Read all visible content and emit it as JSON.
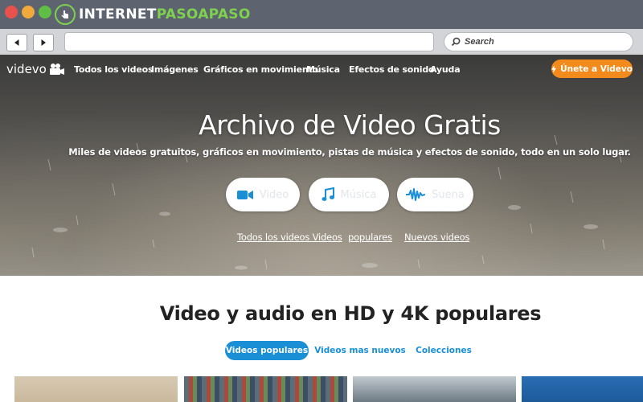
{
  "brand": {
    "internet": "INTERNET",
    "paso": "PASOAPASO"
  },
  "browser": {
    "search_placeholder": "Search",
    "address_value": ""
  },
  "site": {
    "logo_text": "videvo",
    "nav": [
      "Todos los videos",
      "Imágenes",
      "Gráficos en movimiento",
      "Música",
      "Efectos de sonido",
      "Ayuda"
    ],
    "join_label": "Únete a Videvo"
  },
  "hero": {
    "title": "Archivo de Video Gratis",
    "subtitle": "Miles de videos gratuitos, gráficos en movimiento, pistas de música y efectos de sonido, todo en un solo lugar.",
    "pills": [
      "Video",
      "Música",
      "Suena"
    ],
    "links": [
      "Todos los videos Videos",
      "populares",
      "Nuevos videos"
    ]
  },
  "section": {
    "title": "Video y audio en HD y 4K populares",
    "tabs": [
      "Videos populares",
      "Videos mas nuevos",
      "Colecciones"
    ]
  },
  "colors": {
    "accent_blue": "#1a8fd6",
    "join_orange": "#f28a1c",
    "brand_green": "#7ed04f",
    "chrome_gray": "#5d6470"
  }
}
